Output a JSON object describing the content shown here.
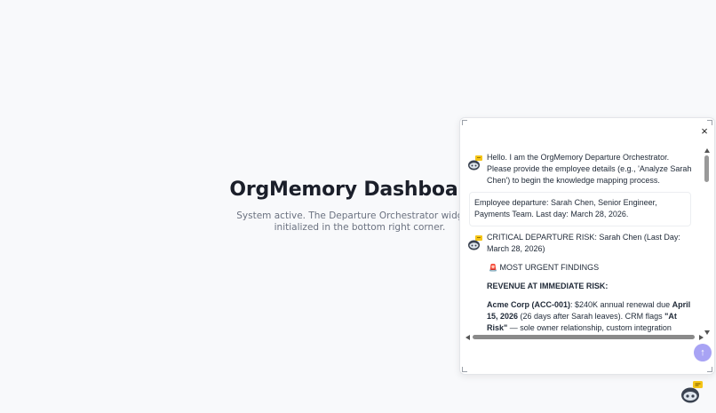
{
  "dashboard": {
    "title": "OrgMemory Dashboard",
    "subtitle": "System active. The Departure Orchestrator widget is initialized in the bottom right corner."
  },
  "widget": {
    "close_label": "×",
    "messages": {
      "bot_intro": "Hello. I am the OrgMemory Departure Orchestrator. Please provide the employee details (e.g., 'Analyze Sarah Chen') to begin the knowledge mapping process.",
      "user_request": "Employee departure: Sarah Chen, Senior Engineer, Payments Team. Last day: March 28, 2026.",
      "bot_report": {
        "heading": "CRITICAL DEPARTURE RISK: Sarah Chen (Last Day: March 28, 2026)",
        "findings_icon": "🚨",
        "findings_label": "MOST URGENT FINDINGS",
        "section": "REVENUE AT IMMEDIATE RISK:",
        "item_account": "Acme Corp (ACC-001)",
        "item_text_1": ": $240K annual renewal due ",
        "item_date": "April 15, 2026",
        "item_text_2": " (26 days after Sarah leaves). CRM flags ",
        "item_flag": "\"At Risk\"",
        "item_text_3": " — sole owner relationship, custom integration failures unresolved, CTO"
      }
    },
    "send_icon": "arrow-up-icon",
    "bot_icon": "robot-chat-icon",
    "colors": {
      "send_button": "#a8a3f4",
      "avatar_badge": "#f5c518",
      "avatar_body": "#3a4250"
    }
  }
}
